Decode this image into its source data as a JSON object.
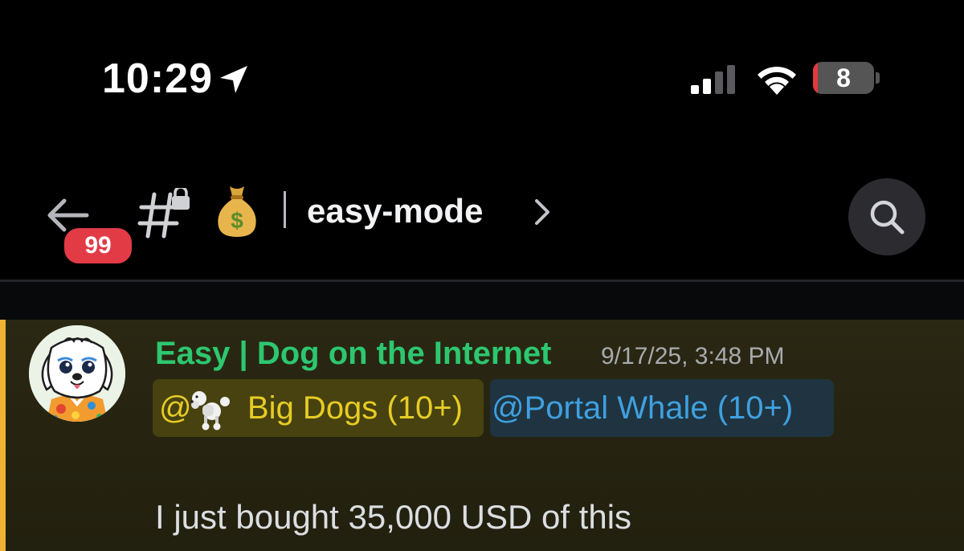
{
  "status_bar": {
    "time": "10:29",
    "location_icon": "location-arrow-icon",
    "signal_icon": "cellular-signal-icon",
    "wifi_icon": "wifi-icon",
    "battery_percent": 8,
    "battery_label": "8",
    "battery_color": "#e5393a"
  },
  "header": {
    "back_icon": "arrow-left-icon",
    "unread_count": "99",
    "channel_icon": "locked-hashtag-icon",
    "channel_emoji": "money-bag-icon",
    "channel_name": "easy-mode",
    "chevron_icon": "chevron-right-icon",
    "search_icon": "search-icon"
  },
  "message": {
    "author": "Easy | Dog on the Internet",
    "author_color": "#2dc770",
    "timestamp": "9/17/25, 3:48 PM",
    "mentions": [
      {
        "prefix": "@",
        "icon": "poodle-icon",
        "label": "Big Dogs (10+)",
        "color": "#e6cc25"
      },
      {
        "prefix": "@",
        "label": "@Portal Whale (10+)",
        "color": "#3fa0e0"
      }
    ],
    "text": "I just bought 35,000 USD of this",
    "highlight_color": "#f0b232"
  }
}
